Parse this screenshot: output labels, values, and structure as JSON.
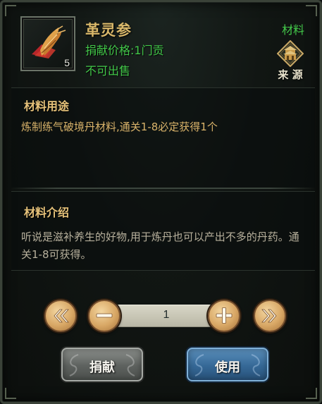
{
  "item": {
    "name": "革灵参",
    "count": "5",
    "price_line": "捐献价格:1门贡",
    "sell_line": "不可出售",
    "type": "材料",
    "icon": "ginseng-root-icon"
  },
  "source": {
    "label": "来 源",
    "icon": "pagoda-icon"
  },
  "usage": {
    "title": "材料用途",
    "text": "炼制练气破境丹材料,通关1-8必定获得1个"
  },
  "intro": {
    "title": "材料介绍",
    "text": "听说是滋补养生的好物,用于炼丹也可以产出不多的丹药。通关1-8可获得。"
  },
  "quantity": {
    "value": "1",
    "first_icon": "double-chevron-left-icon",
    "minus_icon": "minus-icon",
    "plus_icon": "plus-icon",
    "last_icon": "double-chevron-right-icon"
  },
  "actions": {
    "donate_label": "捐献",
    "use_label": "使用"
  },
  "colors": {
    "gold": "#d9b86a",
    "green": "#43c94a",
    "use_blue": "#356896",
    "donate_grey": "#5d615e"
  }
}
